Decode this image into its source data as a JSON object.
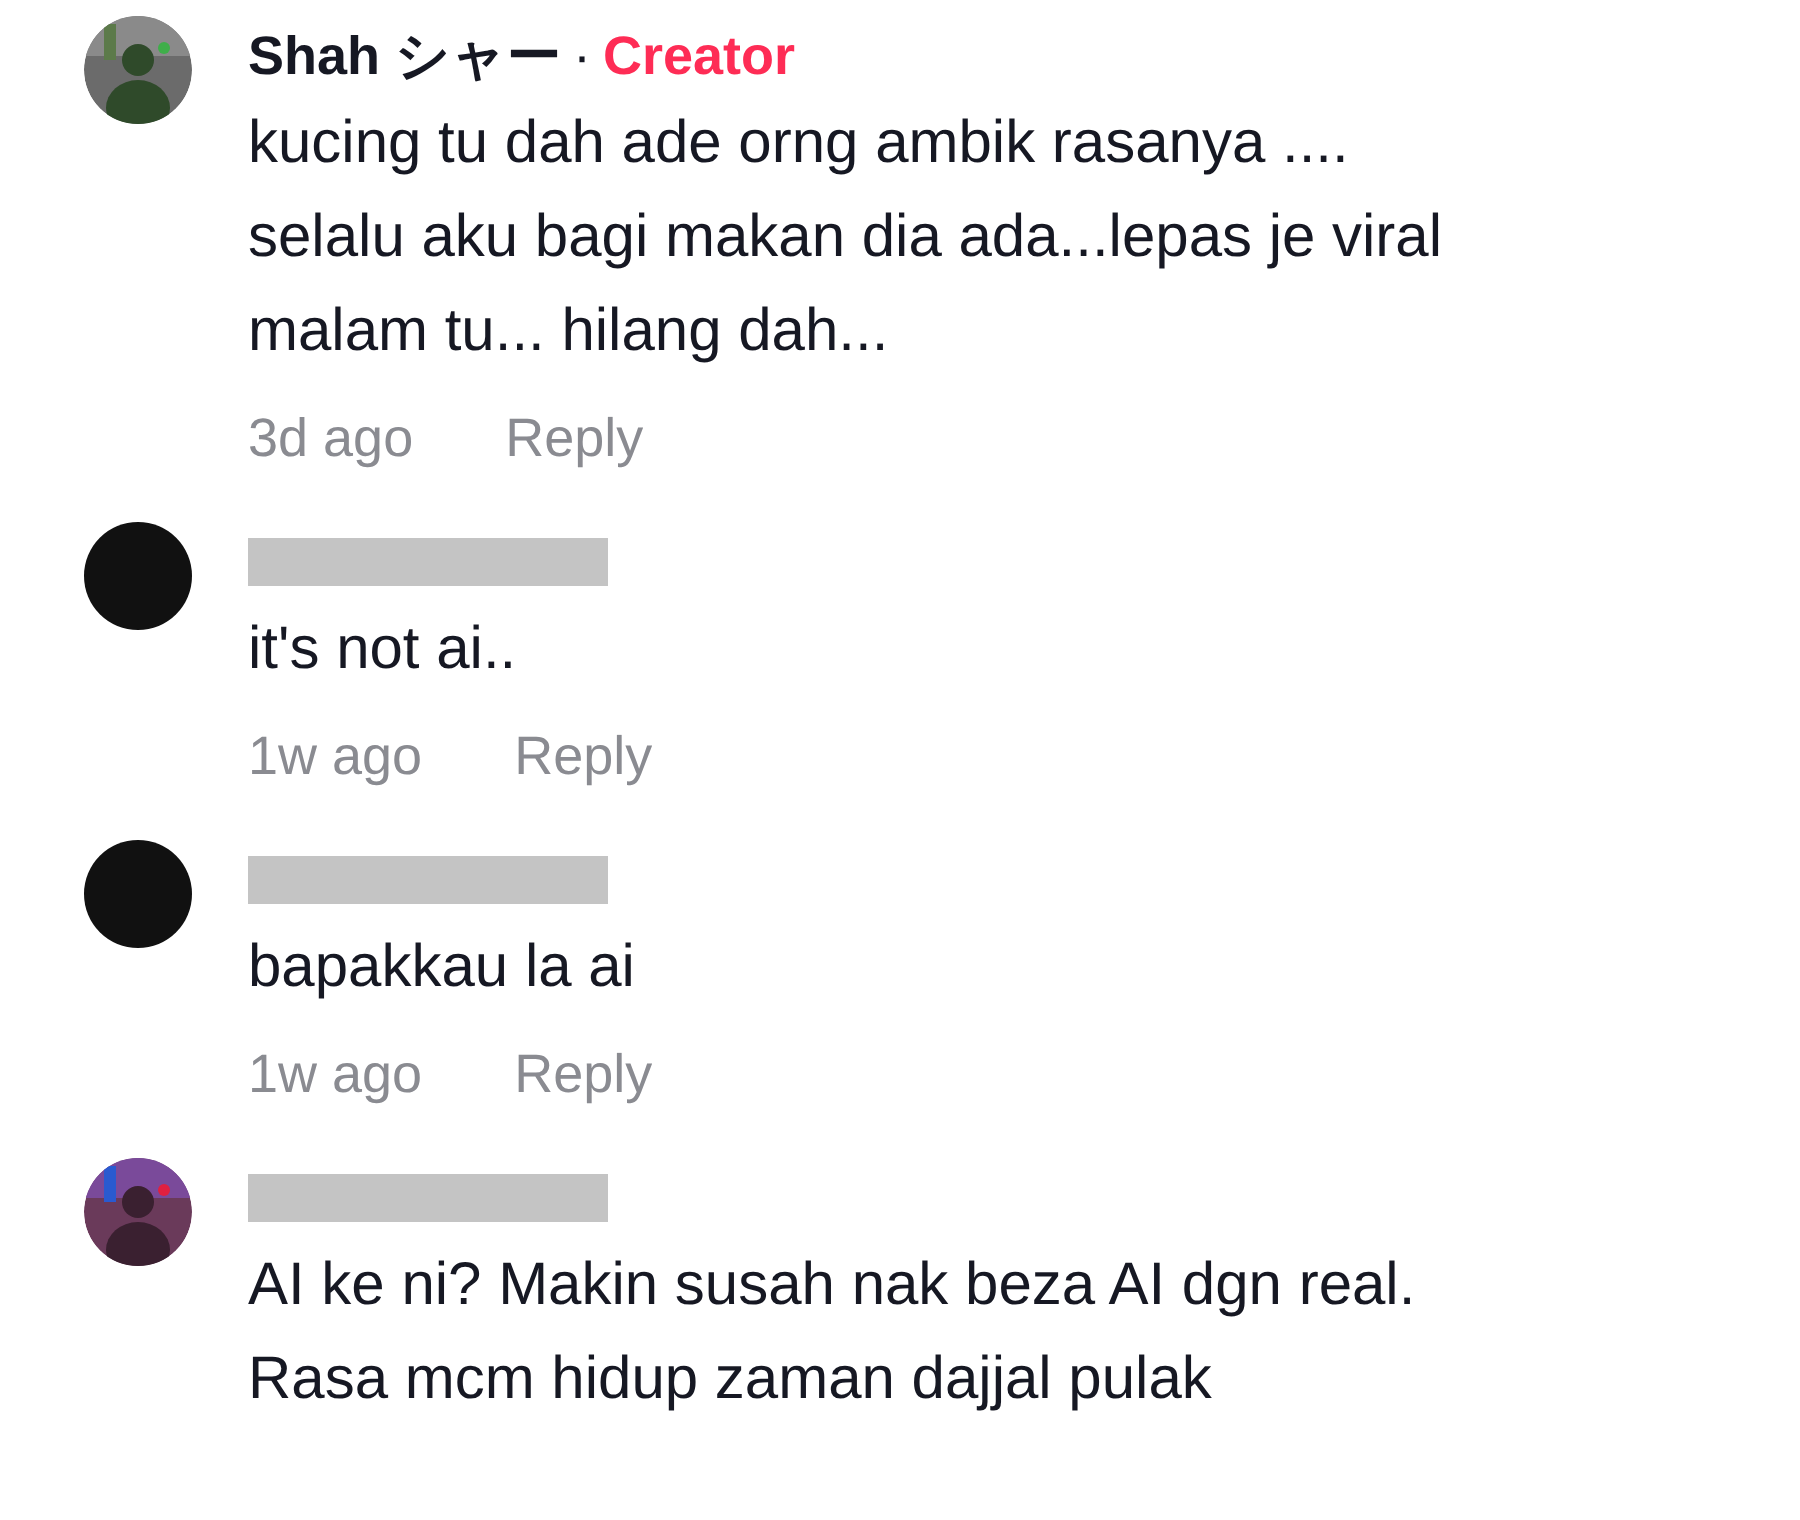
{
  "comments": [
    {
      "avatar": {
        "kind": "picture"
      },
      "author": {
        "kind": "text",
        "name": "Shah シャー",
        "separator": "·",
        "badge": "Creator"
      },
      "lines": [
        "kucing tu dah ade orng ambik rasanya ....",
        "selalu aku bagi makan dia ada...lepas je viral",
        "malam tu... hilang dah..."
      ],
      "time": "3d ago",
      "reply": "Reply"
    },
    {
      "avatar": {
        "kind": "plain"
      },
      "author": {
        "kind": "redacted"
      },
      "lines": [
        "it's not ai.."
      ],
      "time": "1w ago",
      "reply": "Reply"
    },
    {
      "avatar": {
        "kind": "plain"
      },
      "author": {
        "kind": "redacted"
      },
      "lines": [
        "bapakkau la ai"
      ],
      "time": "1w ago",
      "reply": "Reply"
    },
    {
      "avatar": {
        "kind": "picture"
      },
      "author": {
        "kind": "redacted"
      },
      "lines": [
        "AI ke ni? Makin susah nak beza AI dgn real.",
        "Rasa mcm hidup zaman dajjal pulak"
      ]
    }
  ]
}
